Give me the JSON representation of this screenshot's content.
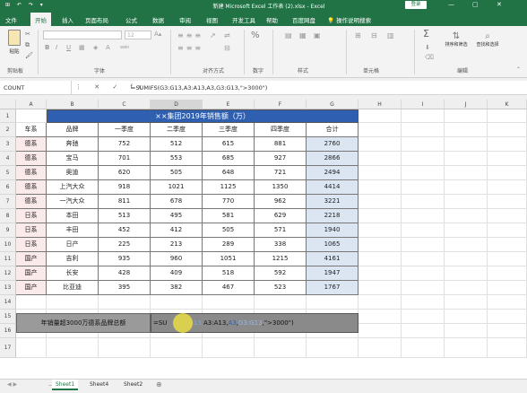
{
  "window": {
    "title": "新建 Microsoft Excel 工作表 (2).xlsx - Excel",
    "login": "登录",
    "minimize": "—",
    "restore": "▢",
    "close": "✕",
    "quick_access": "⊞ ↶ ↷ ▾"
  },
  "tabs": [
    "文件",
    "开始",
    "插入",
    "页面布局",
    "公式",
    "数据",
    "审阅",
    "视图",
    "开发工具",
    "帮助",
    "百度网盘",
    "操作说明搜索"
  ],
  "ribbon": {
    "paste": "粘贴",
    "clipboard": "剪贴板",
    "font_size": "12",
    "font": "字体",
    "bold": "B",
    "italic": "I",
    "underline": "U",
    "wen": "wén",
    "alignment": "对齐方式",
    "number": "数字",
    "number_fmt": "%",
    "percent": "%",
    "styles": "样式",
    "cells": "单元格",
    "editing": "编辑",
    "sum": "Σ",
    "find_select": "查找和选择",
    "sort_filter": "排序和筛选"
  },
  "formula_bar": {
    "name_box": "COUNT",
    "icons": "⋮ ✕ ✓ fx",
    "formula": "=SUMIFS(G3:G13,A3:A13,A3,G3:G13,\">3000\")"
  },
  "grid": {
    "columns": [
      "A",
      "B",
      "C",
      "D",
      "E",
      "F",
      "G",
      "H",
      "I",
      "J",
      "K"
    ],
    "rows": [
      "1",
      "2",
      "3",
      "4",
      "5",
      "6",
      "7",
      "8",
      "9",
      "10",
      "11",
      "12",
      "13",
      "14",
      "15",
      "16",
      "17"
    ],
    "title": "××集团2019年销售额（万）",
    "headers": [
      "车系",
      "品牌",
      "一季度",
      "二季度",
      "三季度",
      "四季度",
      "合计"
    ],
    "data": [
      [
        "德系",
        "奔驰",
        "752",
        "512",
        "615",
        "881",
        "2760"
      ],
      [
        "德系",
        "宝马",
        "701",
        "553",
        "685",
        "927",
        "2866"
      ],
      [
        "德系",
        "奥迪",
        "620",
        "505",
        "648",
        "721",
        "2494"
      ],
      [
        "德系",
        "上汽大众",
        "918",
        "1021",
        "1125",
        "1350",
        "4414"
      ],
      [
        "德系",
        "一汽大众",
        "811",
        "678",
        "770",
        "962",
        "3221"
      ],
      [
        "日系",
        "本田",
        "513",
        "495",
        "581",
        "629",
        "2218"
      ],
      [
        "日系",
        "丰田",
        "452",
        "412",
        "505",
        "571",
        "1940"
      ],
      [
        "日系",
        "日产",
        "225",
        "213",
        "289",
        "338",
        "1065"
      ],
      [
        "国产",
        "吉利",
        "935",
        "960",
        "1051",
        "1215",
        "4161"
      ],
      [
        "国产",
        "长安",
        "428",
        "409",
        "518",
        "592",
        "1947"
      ],
      [
        "国产",
        "比亚迪",
        "395",
        "382",
        "467",
        "523",
        "1767"
      ]
    ],
    "criteria_label": "年销量超3000万德系品牌总额",
    "formula_cell_prefix": "=SU",
    "formula_cell_mid": "G13,",
    "formula_cell_a": "A3:A13,",
    "formula_cell_a3": "A3",
    "formula_cell_g": "G3:G13",
    "formula_cell_end": ",\">3000\")"
  },
  "sheets": [
    "Sheet1",
    "Sheet4",
    "Sheet2"
  ],
  "active_sheet": "Sheet1",
  "add_sheet": "⊕",
  "colors": {
    "excel_green": "#217346",
    "title_blue": "#2e5fb0",
    "total_fill": "#dce6f2",
    "ref_a": "#2e5fb0",
    "ref_b": "#c0392b"
  }
}
